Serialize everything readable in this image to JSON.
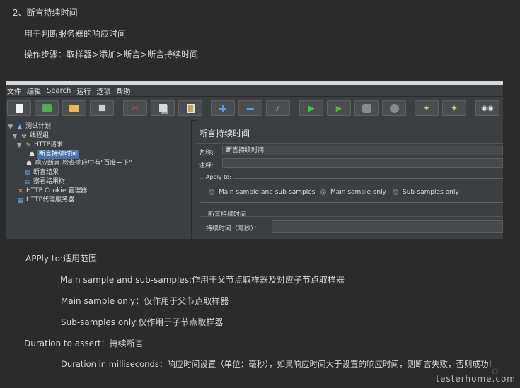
{
  "doc": {
    "heading": "2、断言持续时间",
    "purpose": "用于判断服务器的响应时间",
    "steps": "操作步骤：取样器>添加>断言>断言持续时间",
    "apply_to": "APPly to:适用范围",
    "main_and_sub": "Main sample and sub-samples:作用于父节点取样器及对应子节点取样器",
    "main_only": "Main sample only：仅作用于父节点取样器",
    "sub_only": "Sub-samples only:仅作用于子节点取样器",
    "duration_to_assert": "Duration to assert：持续断言",
    "duration_ms": "Duration in milliseconds：响应时间设置（单位：毫秒），如果响应时间大于设置的响应时间，则断言失败，否则成功!"
  },
  "jmeter": {
    "menu": [
      "文件",
      "编辑",
      "Search",
      "运行",
      "选项",
      "帮助"
    ],
    "toolbar_icons": [
      "new-icon",
      "templates-icon",
      "open-icon",
      "save-icon",
      "cut-icon",
      "copy-icon",
      "paste-icon",
      "expand-icon",
      "collapse-icon",
      "toggle-icon",
      "start-icon",
      "start-no-pause-icon",
      "stop-icon",
      "shutdown-icon",
      "clear-icon",
      "clear-all-icon",
      "search-icon"
    ],
    "tree": [
      {
        "label": "测试计划",
        "icon": "test-plan-icon"
      },
      {
        "label": "线程组",
        "icon": "thread-group-icon"
      },
      {
        "label": "HTTP请求",
        "icon": "http-sampler-icon"
      },
      {
        "label": "断言持续时间",
        "icon": "assertion-icon",
        "selected": true
      },
      {
        "label": "响应断言-检查响应中有\"百度一下\"",
        "icon": "assertion-icon"
      },
      {
        "label": "断言结果",
        "icon": "listener-icon"
      },
      {
        "label": "察看结果树",
        "icon": "listener-icon"
      },
      {
        "label": "HTTP Cookie 管理器",
        "icon": "cookie-manager-icon"
      },
      {
        "label": "HTTP代理服务器",
        "icon": "proxy-icon"
      }
    ],
    "panel": {
      "title": "断言持续时间",
      "name_label": "名称:",
      "name_value": "断言持续时间",
      "comment_label": "注释:",
      "comment_value": "",
      "apply_legend": "Apply to:",
      "radio_main_sub": "Main sample and sub-samples",
      "radio_main_only": "Main sample only",
      "radio_sub_only": "Sub-samples only",
      "selected_radio": "Main sample only",
      "section_title": "断言持续时间",
      "duration_label": "持续时间（毫秒）：",
      "duration_value": ""
    }
  },
  "watermark": "testerhome.com"
}
